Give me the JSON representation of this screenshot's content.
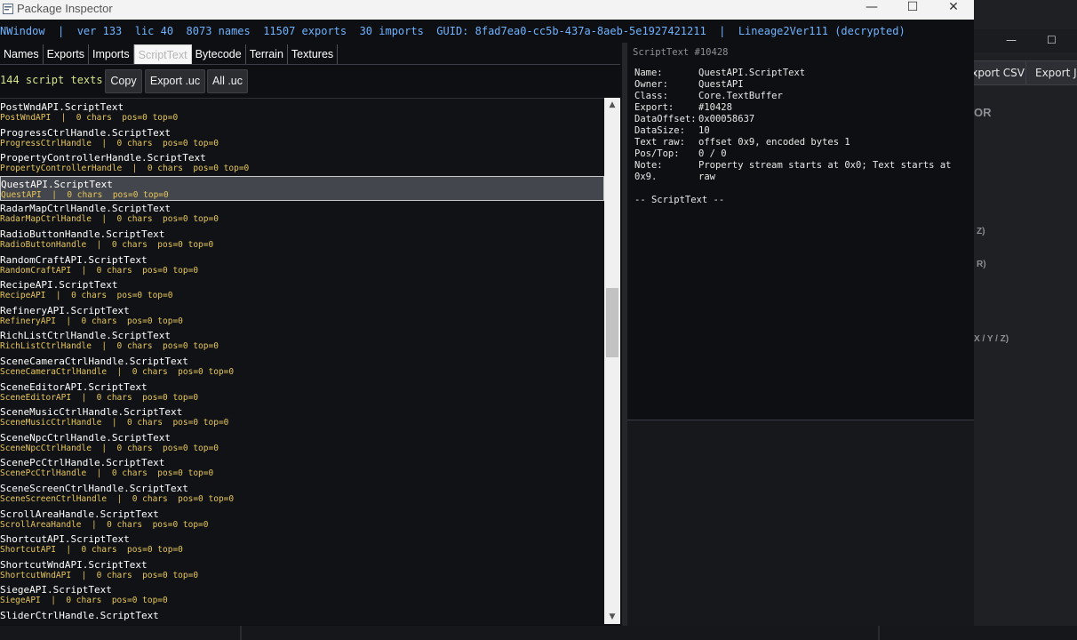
{
  "window": {
    "title": "Package Inspector",
    "controls": {
      "minimize": "—",
      "maximize": "☐",
      "close": "✕"
    }
  },
  "infobar": {
    "text": "NWindow  |  ver 133  lic 40  8073 names  11507 exports  30 imports  GUID: 8fad7ea0-cc5b-437a-8aeb-5e1927421211  |  Lineage2Ver111 (decrypted)"
  },
  "tabs": [
    {
      "label": "Names"
    },
    {
      "label": "Exports"
    },
    {
      "label": "Imports"
    },
    {
      "label": "ScriptText",
      "active": true
    },
    {
      "label": "Bytecode"
    },
    {
      "label": "Terrain"
    },
    {
      "label": "Textures"
    }
  ],
  "toolbar": {
    "count": "144 script texts",
    "copy": "Copy",
    "export_uc": "Export .uc",
    "all_uc": "All .uc"
  },
  "list": [
    {
      "name": "PostWndAPI.ScriptText",
      "info": "PostWndAPI  |  0 chars  pos=0 top=0"
    },
    {
      "name": "ProgressCtrlHandle.ScriptText",
      "info": "ProgressCtrlHandle  |  0 chars  pos=0 top=0"
    },
    {
      "name": "PropertyControllerHandle.ScriptText",
      "info": "PropertyControllerHandle  |  0 chars  pos=0 top=0"
    },
    {
      "name": "QuestAPI.ScriptText",
      "info": "QuestAPI  |  0 chars  pos=0 top=0",
      "selected": true
    },
    {
      "name": "RadarMapCtrlHandle.ScriptText",
      "info": "RadarMapCtrlHandle  |  0 chars  pos=0 top=0"
    },
    {
      "name": "RadioButtonHandle.ScriptText",
      "info": "RadioButtonHandle  |  0 chars  pos=0 top=0"
    },
    {
      "name": "RandomCraftAPI.ScriptText",
      "info": "RandomCraftAPI  |  0 chars  pos=0 top=0"
    },
    {
      "name": "RecipeAPI.ScriptText",
      "info": "RecipeAPI  |  0 chars  pos=0 top=0"
    },
    {
      "name": "RefineryAPI.ScriptText",
      "info": "RefineryAPI  |  0 chars  pos=0 top=0"
    },
    {
      "name": "RichListCtrlHandle.ScriptText",
      "info": "RichListCtrlHandle  |  0 chars  pos=0 top=0"
    },
    {
      "name": "SceneCameraCtrlHandle.ScriptText",
      "info": "SceneCameraCtrlHandle  |  0 chars  pos=0 top=0"
    },
    {
      "name": "SceneEditorAPI.ScriptText",
      "info": "SceneEditorAPI  |  0 chars  pos=0 top=0"
    },
    {
      "name": "SceneMusicCtrlHandle.ScriptText",
      "info": "SceneMusicCtrlHandle  |  0 chars  pos=0 top=0"
    },
    {
      "name": "SceneNpcCtrlHandle.ScriptText",
      "info": "SceneNpcCtrlHandle  |  0 chars  pos=0 top=0"
    },
    {
      "name": "ScenePcCtrlHandle.ScriptText",
      "info": "ScenePcCtrlHandle  |  0 chars  pos=0 top=0"
    },
    {
      "name": "SceneScreenCtrlHandle.ScriptText",
      "info": "SceneScreenCtrlHandle  |  0 chars  pos=0 top=0"
    },
    {
      "name": "ScrollAreaHandle.ScriptText",
      "info": "ScrollAreaHandle  |  0 chars  pos=0 top=0"
    },
    {
      "name": "ShortcutAPI.ScriptText",
      "info": "ShortcutAPI  |  0 chars  pos=0 top=0"
    },
    {
      "name": "ShortcutWndAPI.ScriptText",
      "info": "ShortcutWndAPI  |  0 chars  pos=0 top=0"
    },
    {
      "name": "SiegeAPI.ScriptText",
      "info": "SiegeAPI  |  0 chars  pos=0 top=0"
    },
    {
      "name": "SliderCtrlHandle.ScriptText",
      "info": ""
    }
  ],
  "detail": {
    "header": "ScriptText #10428",
    "fields": [
      {
        "key": "Name:",
        "value": "QuestAPI.ScriptText"
      },
      {
        "key": "Owner:",
        "value": "QuestAPI"
      },
      {
        "key": "Class:",
        "value": "Core.TextBuffer"
      },
      {
        "key": "Export:",
        "value": "#10428"
      },
      {
        "key": "DataOffset:",
        "value": "0x00058637"
      },
      {
        "key": "DataSize:",
        "value": "10"
      },
      {
        "key": "Text raw:",
        "value": "offset 0x9, encoded bytes 1"
      },
      {
        "key": "Pos/Top:",
        "value": "0 / 0"
      }
    ],
    "note_key": "Note:",
    "note_value": "Property stream starts at 0x0; Text starts at raw",
    "note_value2": "0x9.",
    "footer": "-- ScriptText --"
  },
  "background_window": {
    "buttons": [
      "Export CSV",
      "Export JS"
    ],
    "labels": [
      "OR",
      "Z)",
      "R)",
      "X / Y / Z)"
    ]
  },
  "colors": {
    "background": "#0d0f12",
    "info_text": "#6fb2ff",
    "count_text": "#d5e28a",
    "secondary_text": "#e6c65a",
    "selection": "#43464c"
  }
}
